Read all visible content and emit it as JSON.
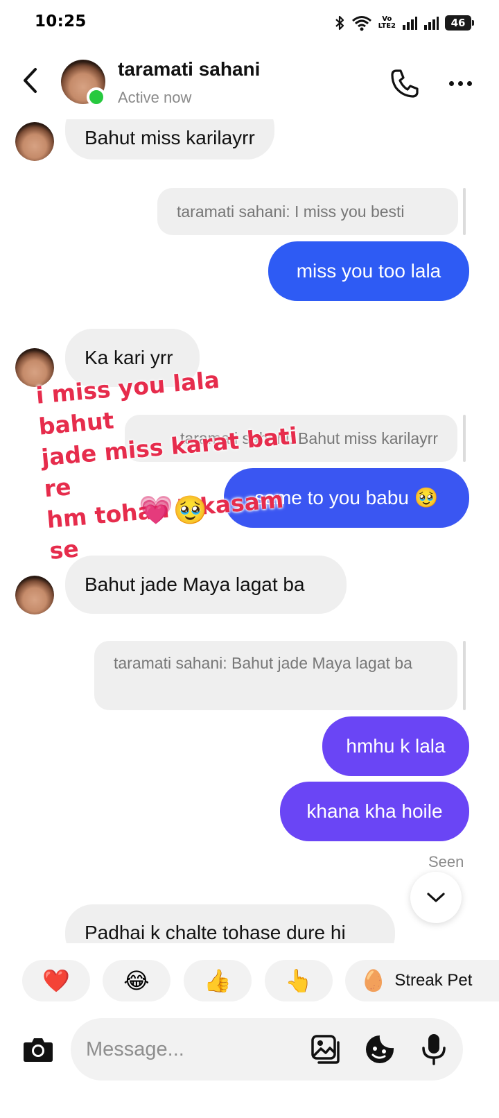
{
  "status_bar": {
    "time": "10:25",
    "volte_top": "Vo",
    "volte_bottom": "LTE2",
    "battery": "46"
  },
  "header": {
    "contact_name": "taramati sahani",
    "contact_status": "Active now",
    "back_icon": "chevron-left-icon",
    "call_icon": "phone-icon",
    "more_icon": "more-horizontal-icon"
  },
  "messages": [
    {
      "type": "received",
      "text": "Bahut miss karilayrr"
    },
    {
      "type": "reply_quote",
      "text": "taramati sahani: I miss you besti"
    },
    {
      "type": "sent",
      "text": "miss you too lala",
      "color": "#2e5bf4"
    },
    {
      "type": "received",
      "text": "Ka kari yrr"
    },
    {
      "type": "reply_quote",
      "text": "taramati sahani: Bahut miss karilayrr"
    },
    {
      "type": "sent",
      "text": "same to you babu 🥹",
      "color": "#3a56f2"
    },
    {
      "type": "received",
      "text": "Bahut jade Maya lagat ba"
    },
    {
      "type": "reply_quote",
      "text": "taramati sahani: Bahut jade Maya lagat ba"
    },
    {
      "type": "sent",
      "text": "hmhu k lala",
      "color": "#6a45f5"
    },
    {
      "type": "sent",
      "text": "khana kha hoile",
      "color": "#6a45f5"
    },
    {
      "type": "received",
      "text": "Padhai k chalte tohase dure hi"
    }
  ],
  "overlay": {
    "lines": [
      "i miss you lala bahut",
      "jade miss karat bati re",
      "hm tohan k kasam se"
    ],
    "emoji": "💗🥹"
  },
  "seen": "Seen",
  "quick_reactions": [
    "❤️",
    "😂",
    "👍",
    "👆"
  ],
  "streak": {
    "emoji": "🥚",
    "label": "Streak Pet"
  },
  "composer": {
    "placeholder": "Message...",
    "camera_icon": "camera-icon",
    "gallery_icon": "gallery-icon",
    "sticker_icon": "sticker-icon",
    "mic_icon": "microphone-icon"
  },
  "colors": {
    "sent_blue": "#2e5bf4",
    "sent_purple": "#6a45f5",
    "received_bg": "#efefef",
    "overlay_text": "#e62c4c",
    "active_dot": "#27c93f"
  }
}
